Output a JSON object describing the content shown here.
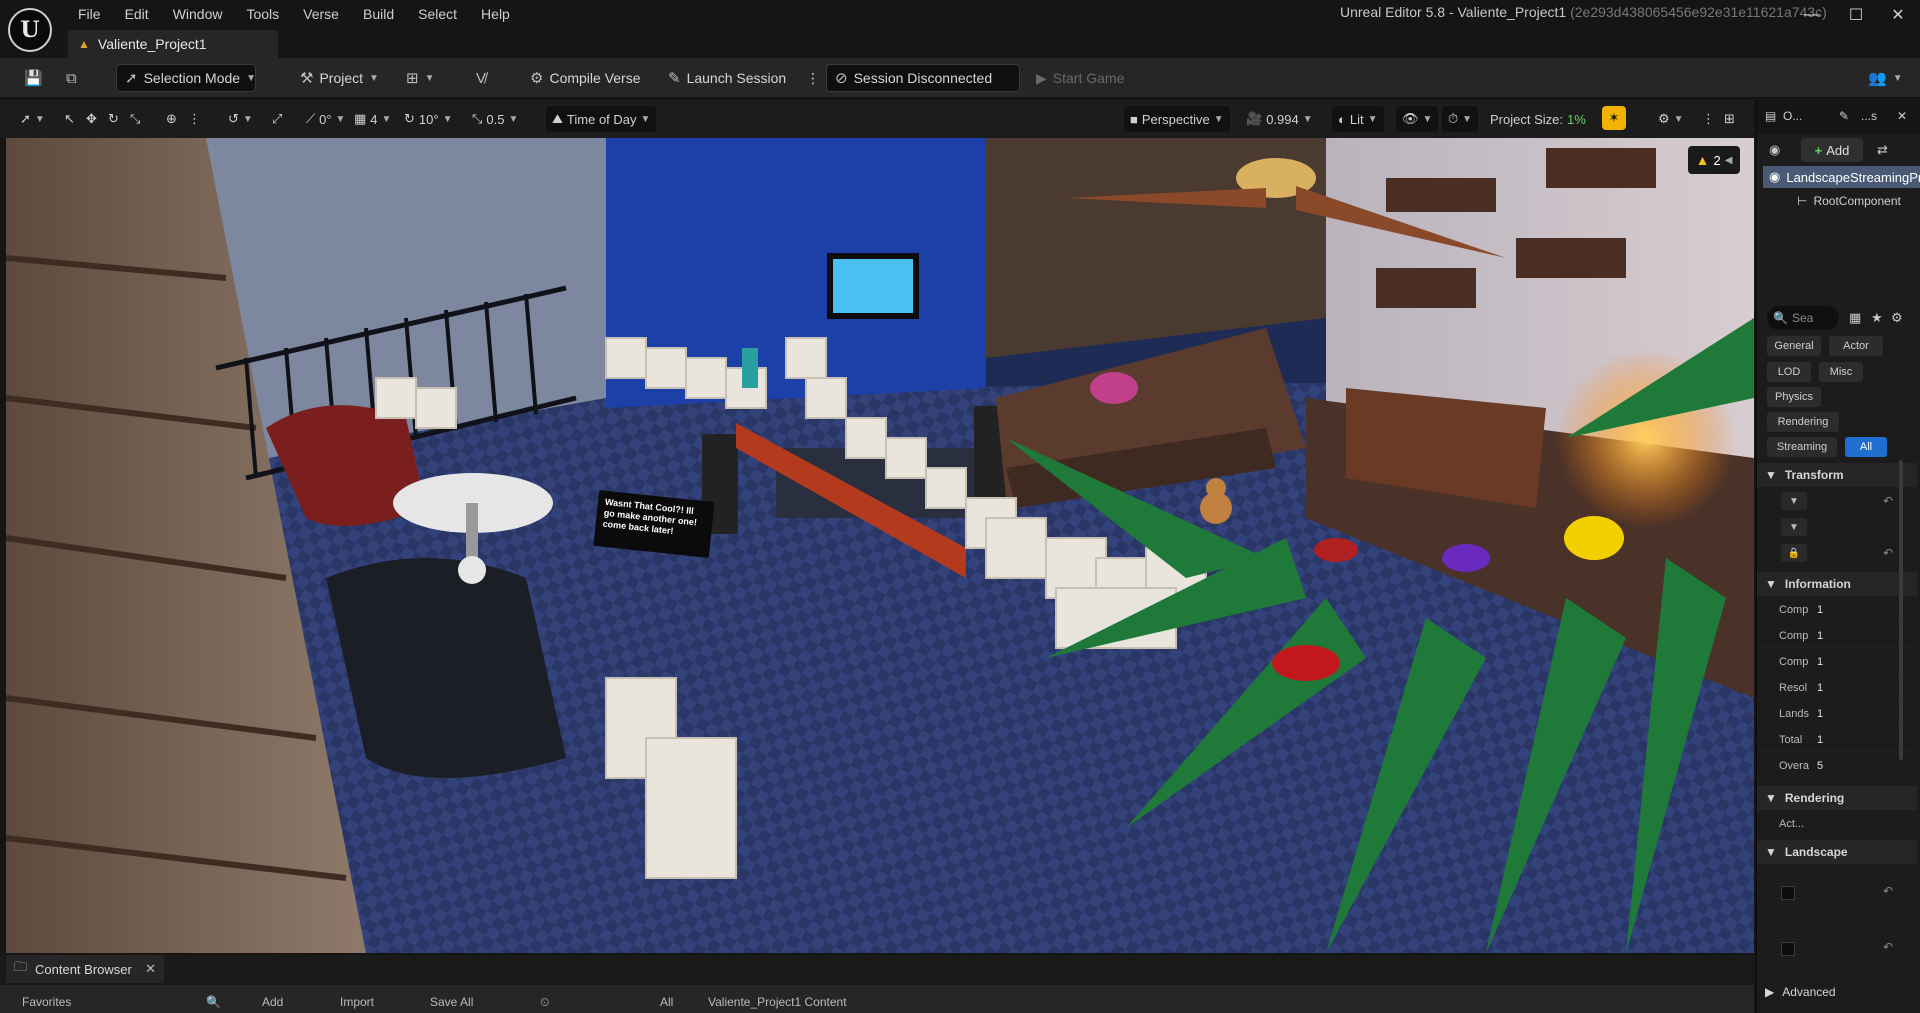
{
  "app": {
    "window_title": "Unreal Editor 5.8 - Valiente_Project1",
    "window_hash": "(2e293d438065456e92e31e11621a743c)",
    "project_tab": "Valiente_Project1"
  },
  "menu": [
    "File",
    "Edit",
    "Window",
    "Tools",
    "Verse",
    "Build",
    "Select",
    "Help"
  ],
  "toolbar": {
    "selection_mode": "Selection Mode",
    "project": "Project",
    "compile_verse": "Compile Verse",
    "launch_session": "Launch Session",
    "session_status": "Session Disconnected",
    "start_game": "Start Game"
  },
  "viewport_toolbar": {
    "rotation_snap": "0°",
    "grid_snap": "4",
    "angle_snap": "10°",
    "scale_snap": "0.5",
    "time_of_day": "Time of Day",
    "perspective": "Perspective",
    "camera_speed": "0.994",
    "view_mode": "Lit",
    "project_size_label": "Project Size:",
    "project_size_value": "1%",
    "warnings_count": "2"
  },
  "scene": {
    "speech_bubble": "Wasnt That Cool?! Ill go make another one! come back later!"
  },
  "content_browser": {
    "tab_label": "Content Browser",
    "favorites": "Favorites",
    "add": "Add",
    "import": "Import",
    "save_all": "Save All",
    "path_all": "All",
    "path_project": "Valiente_Project1 Content"
  },
  "details": {
    "tab1": "O...",
    "tab2": "...s",
    "add_label": "Add",
    "component_root": "LandscapeStreamingProxy",
    "component_child": "RootComponent",
    "search_placeholder": "Sea",
    "filters": [
      "General",
      "Actor",
      "LOD",
      "Misc",
      "Physics",
      "Rendering",
      "Streaming",
      "All"
    ],
    "sections": {
      "transform": "Transform",
      "information": "Information",
      "rendering": "Rendering",
      "landscape": "Landscape",
      "advanced": "Advanced"
    },
    "info_rows": [
      {
        "key": "Comp",
        "value": "1"
      },
      {
        "key": "Comp",
        "value": "1"
      },
      {
        "key": "Comp",
        "value": "1"
      },
      {
        "key": "Resol",
        "value": "1"
      },
      {
        "key": "Lands",
        "value": "1"
      },
      {
        "key": "Total",
        "value": "1"
      },
      {
        "key": "Overa",
        "value": "5"
      }
    ],
    "rendering_row": "Act..."
  },
  "colors": {
    "accent_blue": "#1f6fd0",
    "warning_yellow": "#f0b400",
    "green": "#6ad06a"
  }
}
